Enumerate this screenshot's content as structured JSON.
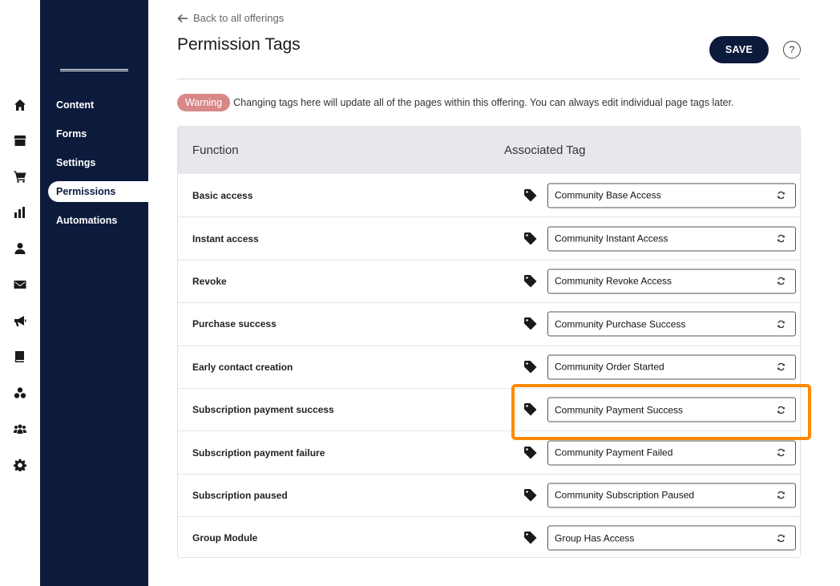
{
  "rail": {
    "icons": [
      "home-icon",
      "store-icon",
      "cart-icon",
      "chart-icon",
      "person-icon",
      "mail-icon",
      "megaphone-icon",
      "book-icon",
      "circles-icon",
      "people-icon",
      "gear-icon"
    ]
  },
  "subnav": {
    "items": [
      {
        "label": "Content",
        "active": false
      },
      {
        "label": "Forms",
        "active": false
      },
      {
        "label": "Settings",
        "active": false
      },
      {
        "label": "Permissions",
        "active": true
      },
      {
        "label": "Automations",
        "active": false
      }
    ]
  },
  "header": {
    "back_label": "Back to all offerings",
    "title": "Permission Tags",
    "save_label": "SAVE",
    "help_label": "?"
  },
  "warning": {
    "badge": "Warning",
    "text": "Changing tags here will update all of the pages within this offering. You can always edit individual page tags later."
  },
  "table": {
    "columns": [
      "Function",
      "Associated Tag"
    ],
    "rows": [
      {
        "function": "Basic access",
        "tag": "Community Base Access"
      },
      {
        "function": "Instant access",
        "tag": "Community Instant Access"
      },
      {
        "function": "Revoke",
        "tag": "Community Revoke Access"
      },
      {
        "function": "Purchase success",
        "tag": "Community Purchase Success"
      },
      {
        "function": "Early contact creation",
        "tag": "Community Order Started"
      },
      {
        "function": "Subscription payment success",
        "tag": "Community Payment Success"
      },
      {
        "function": "Subscription payment failure",
        "tag": "Community Payment Failed"
      },
      {
        "function": "Subscription paused",
        "tag": "Community Subscription Paused"
      },
      {
        "function": "Group Module",
        "tag": "Group Has Access"
      }
    ]
  },
  "colors": {
    "navy": "#0c1a3c",
    "warning": "#d98787",
    "highlight": "#ff8a00"
  }
}
